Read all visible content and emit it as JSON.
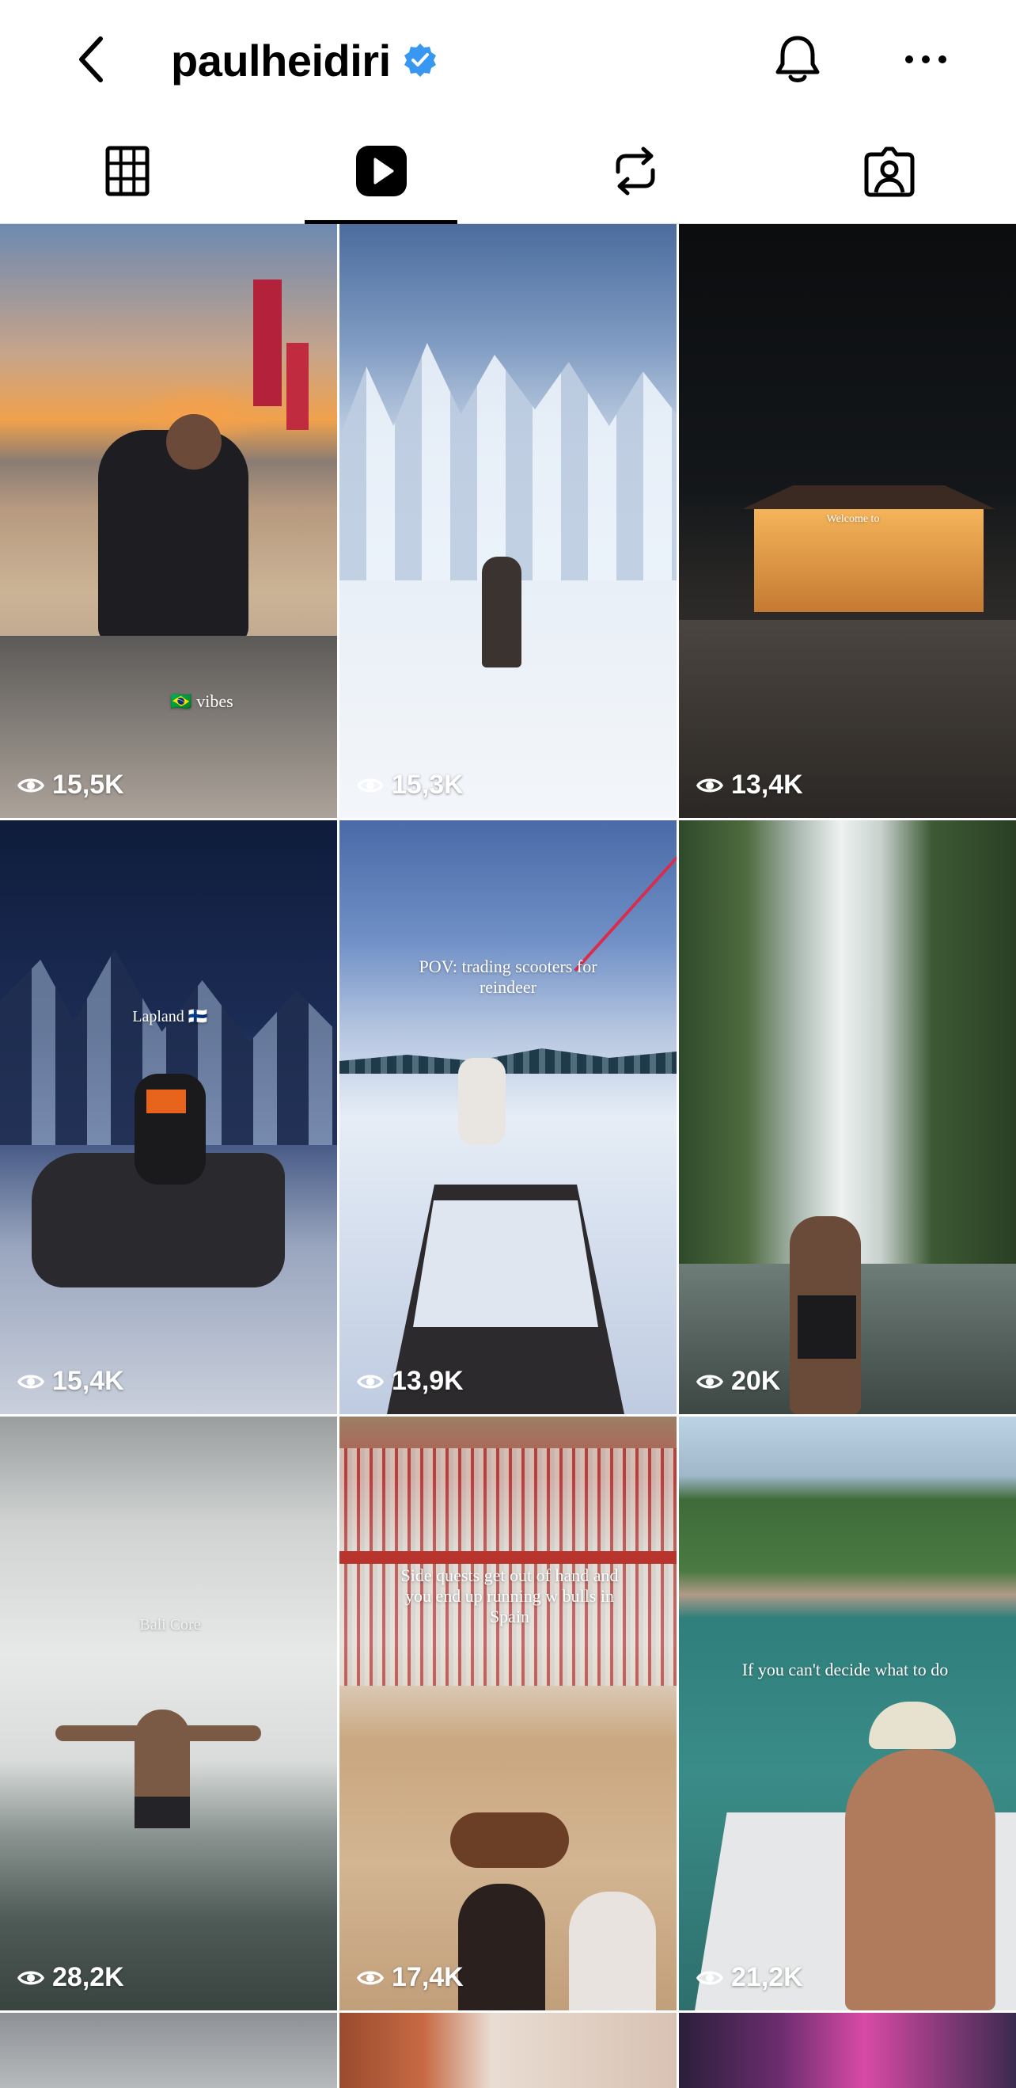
{
  "profile": {
    "username": "paulheidiri"
  },
  "tabs": [
    {
      "name": "posts-grid",
      "icon": "grid-icon",
      "active": false
    },
    {
      "name": "reels",
      "icon": "reels-play-icon",
      "active": true
    },
    {
      "name": "reposts",
      "icon": "repost-icon",
      "active": false
    },
    {
      "name": "tagged",
      "icon": "tagged-person-icon",
      "active": false
    }
  ],
  "reels": [
    {
      "views": "15,5K",
      "caption": "🇧🇷 vibes"
    },
    {
      "views": "15,3K",
      "caption": ""
    },
    {
      "views": "13,4K",
      "caption": "Welcome to"
    },
    {
      "views": "15,4K",
      "caption": "Lapland 🇫🇮"
    },
    {
      "views": "13,9K",
      "caption": "POV: trading scooters for reindeer"
    },
    {
      "views": "20K",
      "caption": ""
    },
    {
      "views": "28,2K",
      "caption": "Bali Core"
    },
    {
      "views": "17,4K",
      "caption": "Side quests get out of hand and you end up running w bulls in Spain"
    },
    {
      "views": "21,2K",
      "caption": "If you can't decide what to do"
    }
  ],
  "colors": {
    "verified": "#3897f0",
    "text": "#000000",
    "divider": "#dbdbdb"
  }
}
